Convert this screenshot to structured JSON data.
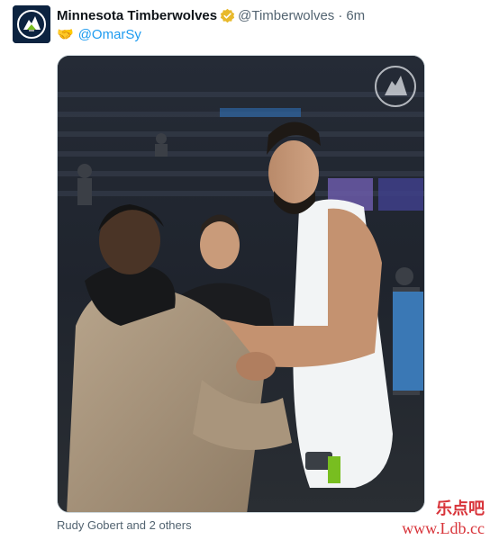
{
  "tweet": {
    "author_name": "Minnesota Timberwolves",
    "handle": "@Timberwolves",
    "separator": "·",
    "time": "6m",
    "emoji": "🤝",
    "mention": "@OmarSy",
    "tagged_people": "Rudy Gobert and 2 others"
  },
  "colors": {
    "link": "#1d9bf0",
    "secondary_text": "#536471",
    "verified_badge": "#e8b92b",
    "avatar_bg": "#0c2340"
  },
  "icons": {
    "avatar": "timberwolves-logo-icon",
    "verified": "verified-badge-icon",
    "photo_logo": "timberwolves-logo-icon"
  },
  "watermark": {
    "text": "乐点吧",
    "url": "www.Ldb.cc"
  }
}
